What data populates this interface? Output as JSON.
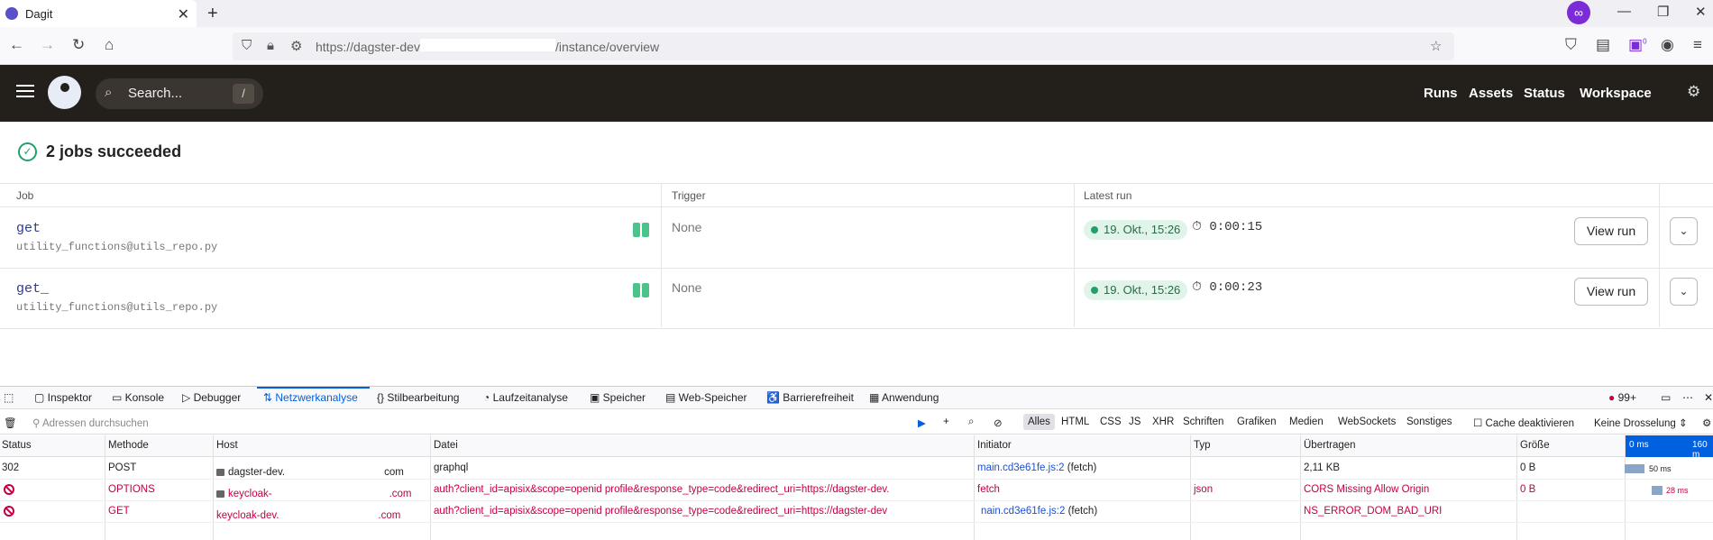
{
  "browser": {
    "tab_title": "Dagit",
    "tab_close": "✕",
    "new_tab": "+",
    "url_prefix": "https://dagster-dev",
    "url_suffix": "/instance/overview",
    "badge_count": "0"
  },
  "header": {
    "search_placeholder": "Search...",
    "search_shortcut": "/",
    "nav": [
      "Runs",
      "Assets",
      "Status",
      "Workspace"
    ]
  },
  "summary": {
    "text": "2 jobs succeeded"
  },
  "table": {
    "columns": [
      "Job",
      "Trigger",
      "Latest run"
    ],
    "rows": [
      {
        "name": "get",
        "repo": "utility_functions@utils_repo.py",
        "trigger": "None",
        "run_date": "19. Okt., 15:26",
        "duration": "0:00:15",
        "view_label": "View run"
      },
      {
        "name": "get_",
        "repo": "utility_functions@utils_repo.py",
        "trigger": "None",
        "run_date": "19. Okt., 15:26",
        "duration": "0:00:23",
        "view_label": "View run"
      }
    ]
  },
  "devtools": {
    "tabs": [
      "Inspektor",
      "Konsole",
      "Debugger",
      "Netzwerkanalyse",
      "Stilbearbeitung",
      "Laufzeitanalyse",
      "Speicher",
      "Web-Speicher",
      "Barrierefreiheit",
      "Anwendung"
    ],
    "error_count": "99+",
    "filter_placeholder": "Adressen durchsuchen",
    "filters": [
      "Alles",
      "HTML",
      "CSS",
      "JS",
      "XHR",
      "Schriften",
      "Grafiken",
      "Medien",
      "WebSockets",
      "Sonstiges"
    ],
    "cache_label": "Cache deaktivieren",
    "throttle_label": "Keine Drosselung ⇕",
    "net_columns": [
      "Status",
      "Methode",
      "Host",
      "Datei",
      "Initiator",
      "Typ",
      "Übertragen",
      "Größe"
    ],
    "timeline_labels": [
      "0 ms",
      "160 m"
    ],
    "requests": [
      {
        "status": "302",
        "method": "POST",
        "host_start": "dagster-dev.",
        "host_end": "com",
        "file": "graphql",
        "initiator": "main.cd3e61fe.js:2",
        "initiator_suffix": "(fetch)",
        "type": "",
        "transferred": "2,11 KB",
        "size": "0 B",
        "timing": "50 ms"
      },
      {
        "status": "",
        "method": "OPTIONS",
        "host_start": "keycloak-",
        "host_end": ".com",
        "file": "auth?client_id=apisix&scope=openid profile&response_type=code&redirect_uri=https://dagster-dev.",
        "initiator": "fetch",
        "initiator_suffix": "",
        "type": "json",
        "transferred": "CORS Missing Allow Origin",
        "size": "0 B",
        "timing": "28 ms"
      },
      {
        "status": "",
        "method": "GET",
        "host_start": "keycloak-dev.",
        "host_end": ".com",
        "file": "auth?client_id=apisix&scope=openid profile&response_type=code&redirect_uri=https://dagster-dev",
        "initiator": "nain.cd3e61fe.js:2",
        "initiator_suffix": "(fetch)",
        "type": "",
        "transferred": "NS_ERROR_DOM_BAD_URI",
        "size": "",
        "timing": ""
      }
    ]
  }
}
